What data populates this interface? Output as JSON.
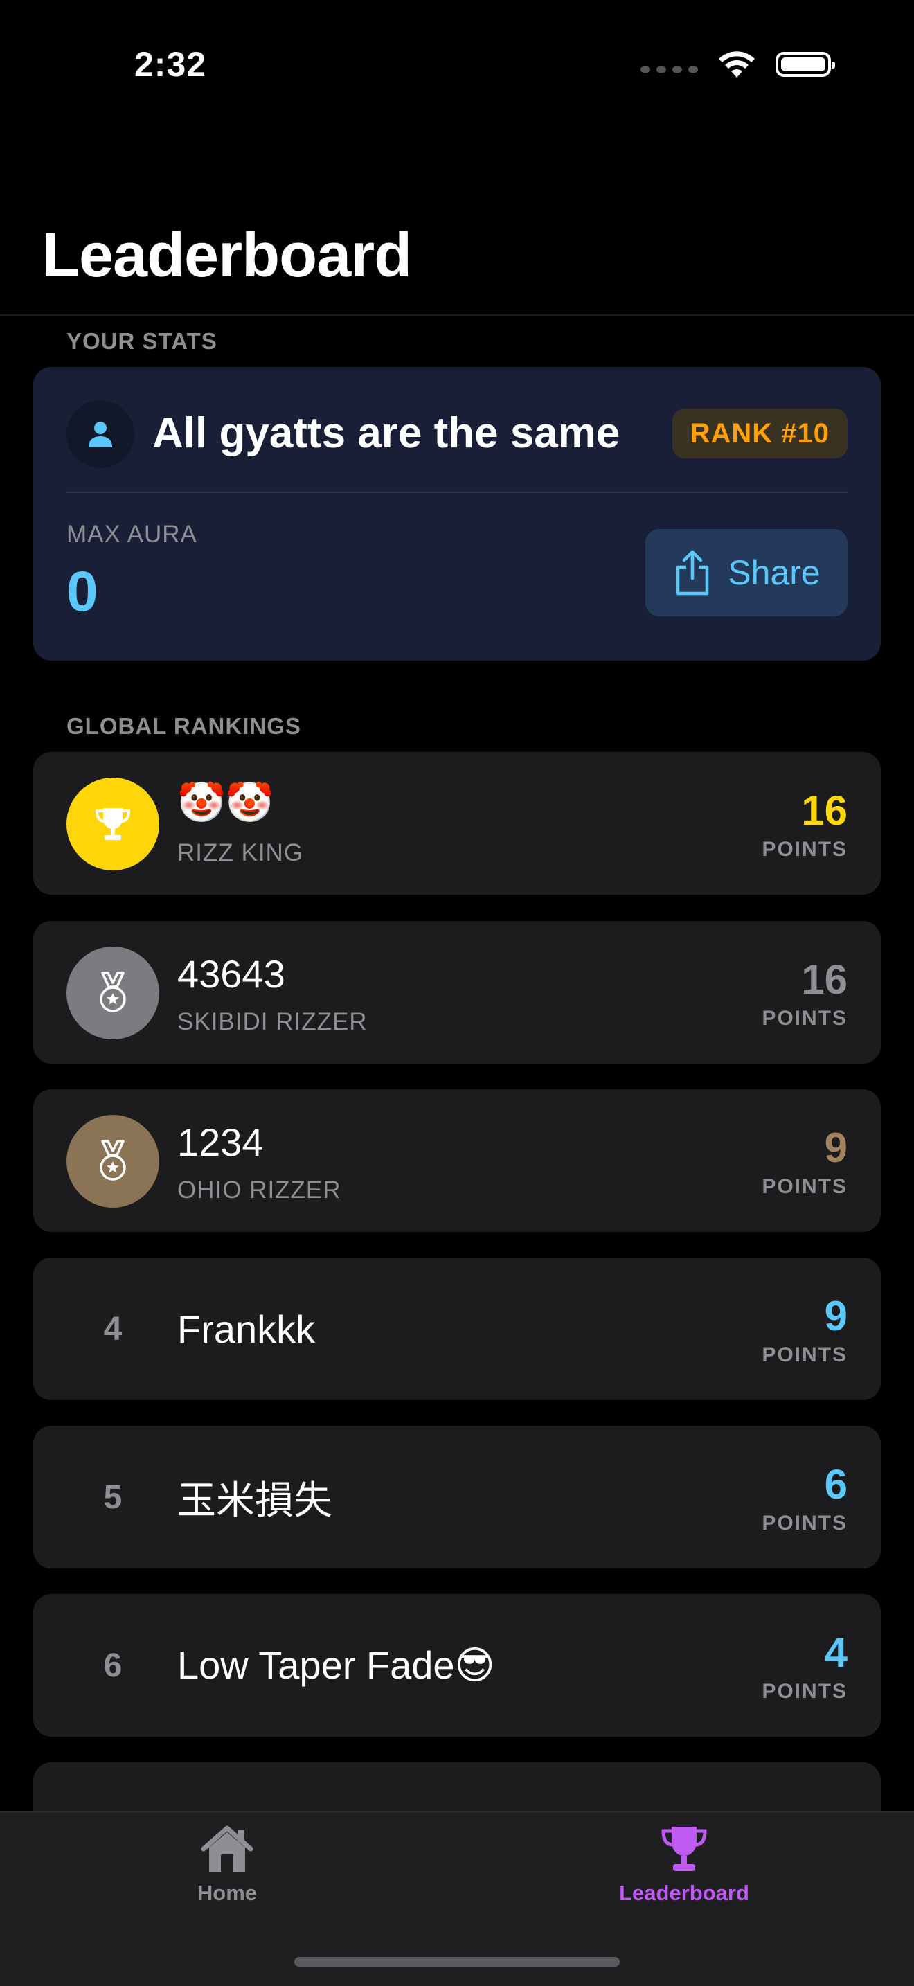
{
  "status_bar": {
    "time": "2:32"
  },
  "header": {
    "title": "Leaderboard"
  },
  "your_stats": {
    "section_label": "YOUR STATS",
    "name": "All gyatts are the same",
    "rank": "RANK #10",
    "max_aura_label": "MAX AURA",
    "max_aura_value": "0",
    "share_label": "Share"
  },
  "global_rankings": {
    "section_label": "GLOBAL RANKINGS",
    "points_label": "POINTS",
    "rows": [
      {
        "rank": "1",
        "name": "🤡🤡",
        "title": "RIZZ KING",
        "points": "16",
        "medal": "trophy-icon",
        "medal_color": "#ffd60a",
        "points_color": "#ffd60a"
      },
      {
        "rank": "2",
        "name": "43643",
        "title": "SKIBIDI RIZZER",
        "points": "16",
        "medal": "medal-icon",
        "medal_color": "#7c7c80",
        "points_color": "#8e8e93"
      },
      {
        "rank": "3",
        "name": "1234",
        "title": "OHIO RIZZER",
        "points": "9",
        "medal": "medal-icon",
        "medal_color": "#8b7355",
        "points_color": "#a2845e"
      },
      {
        "rank": "4",
        "name": "Frankkk",
        "points": "9",
        "points_color": "#5ac8fa"
      },
      {
        "rank": "5",
        "name": "玉米損失",
        "points": "6",
        "points_color": "#5ac8fa"
      },
      {
        "rank": "6",
        "name": "Low Taper Fade😎",
        "points": "4",
        "points_color": "#5ac8fa"
      }
    ]
  },
  "tab_bar": {
    "home_label": "Home",
    "leaderboard_label": "Leaderboard",
    "active_color": "#bf5af2"
  }
}
